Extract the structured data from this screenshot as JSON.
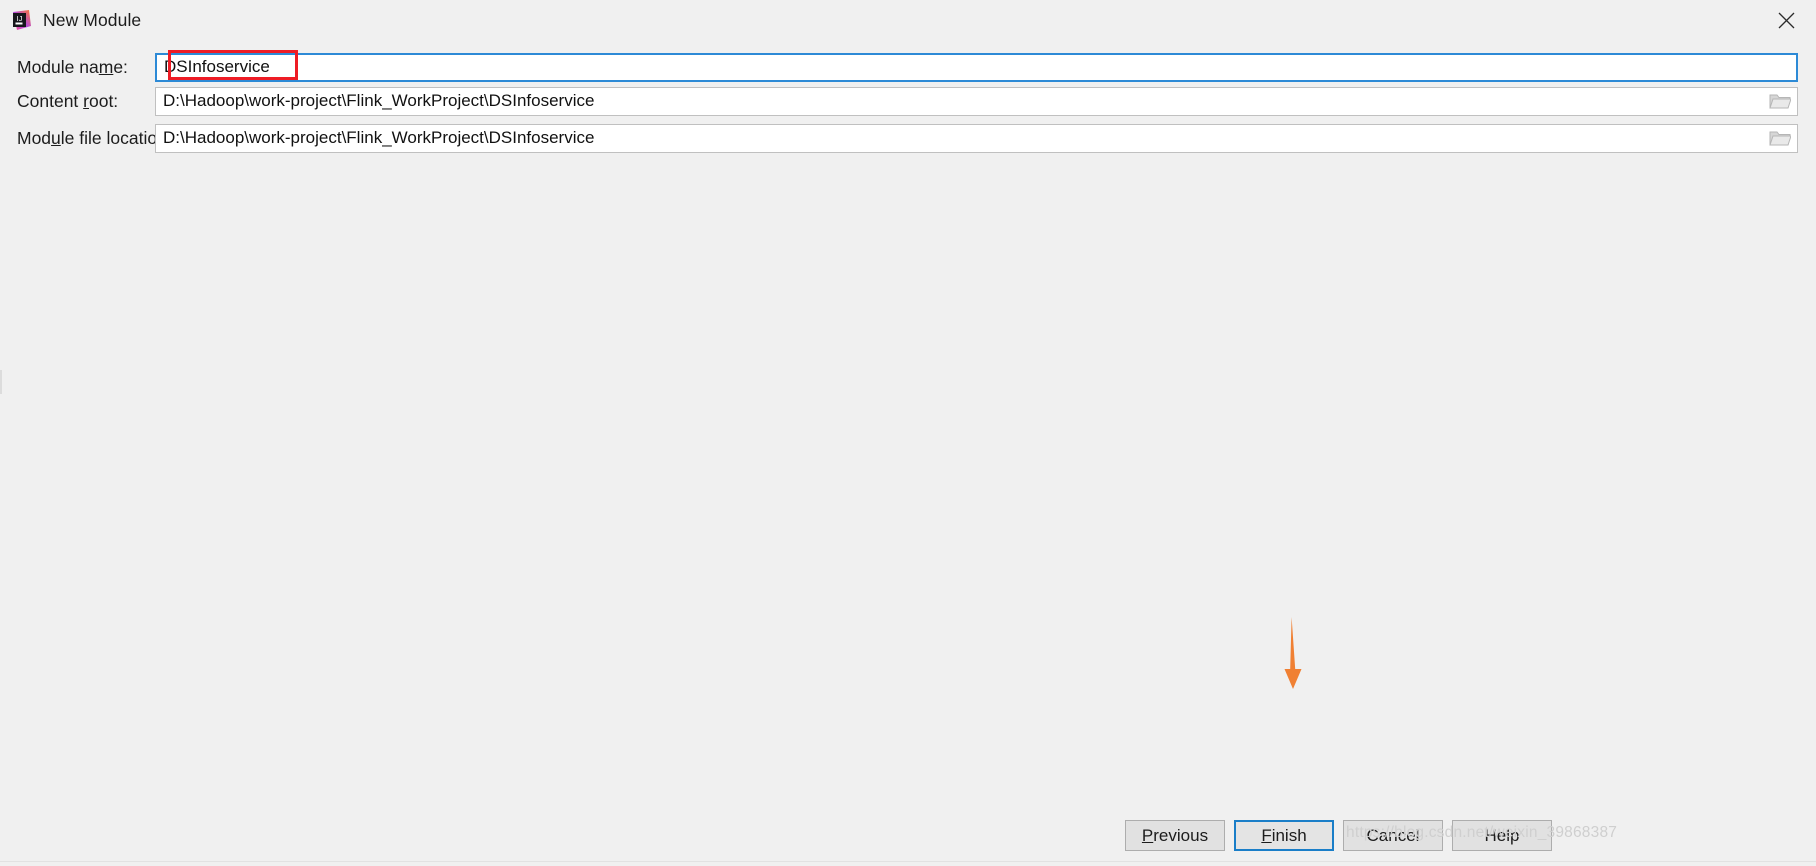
{
  "window": {
    "title": "New Module",
    "logo_icon": "intellij-idea-logo",
    "close_icon": "close-icon"
  },
  "form": {
    "fields": [
      {
        "label_pre": "Module na",
        "label_mnemonic": "m",
        "label_post": "e:",
        "value": "DSInfoservice",
        "placeholder": "",
        "focused": true,
        "has_browse": false,
        "browse_icon": ""
      },
      {
        "label_pre": "Content ",
        "label_mnemonic": "r",
        "label_post": "oot:",
        "value": "D:\\Hadoop\\work-project\\Flink_WorkProject\\DSInfoservice",
        "placeholder": "",
        "focused": false,
        "has_browse": true,
        "browse_icon": "folder-icon"
      },
      {
        "label_pre": "Mod",
        "label_mnemonic": "u",
        "label_post": "le file location:",
        "value": "D:\\Hadoop\\work-project\\Flink_WorkProject\\DSInfoservice",
        "placeholder": "",
        "focused": false,
        "has_browse": true,
        "browse_icon": "folder-icon"
      }
    ]
  },
  "buttons": [
    {
      "pre": "",
      "mnemonic": "P",
      "post": "revious",
      "default": false
    },
    {
      "pre": "",
      "mnemonic": "F",
      "post": "inish",
      "default": true
    },
    {
      "pre": "Cancel",
      "mnemonic": "",
      "post": "",
      "default": false
    },
    {
      "pre": "Help",
      "mnemonic": "",
      "post": "",
      "default": false
    }
  ],
  "annotations": {
    "highlight_box_color": "#ee1c25",
    "arrow_color": "#f08033",
    "arrow_icon": "down-arrow-icon"
  },
  "watermark": {
    "text": "https://blog.csdn.net/weixin_39868387"
  }
}
